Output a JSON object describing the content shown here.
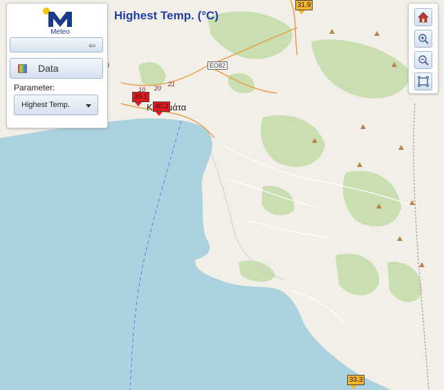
{
  "app": {
    "logo_text": "Meteo",
    "title": "Highest Temp. (°C)"
  },
  "panel": {
    "data_button": "Data",
    "parameter_label": "Parameter:",
    "parameter_value": "Highest Temp."
  },
  "map": {
    "place_label": "Καλαμάτα",
    "road_shield": "EO82",
    "road_numbers": [
      "8",
      "10",
      "20",
      "21"
    ],
    "markers": [
      "39.1",
      "40.3",
      "31.9",
      "33.3"
    ]
  },
  "toolbar": [
    "home-icon",
    "zoom-in-icon",
    "zoom-out-icon",
    "full-extent-icon"
  ],
  "colors": {
    "title": "#1f3fa6",
    "marker_hot": "#e8161d",
    "marker_warm": "#f7b52c",
    "sea": "#aad3df"
  }
}
